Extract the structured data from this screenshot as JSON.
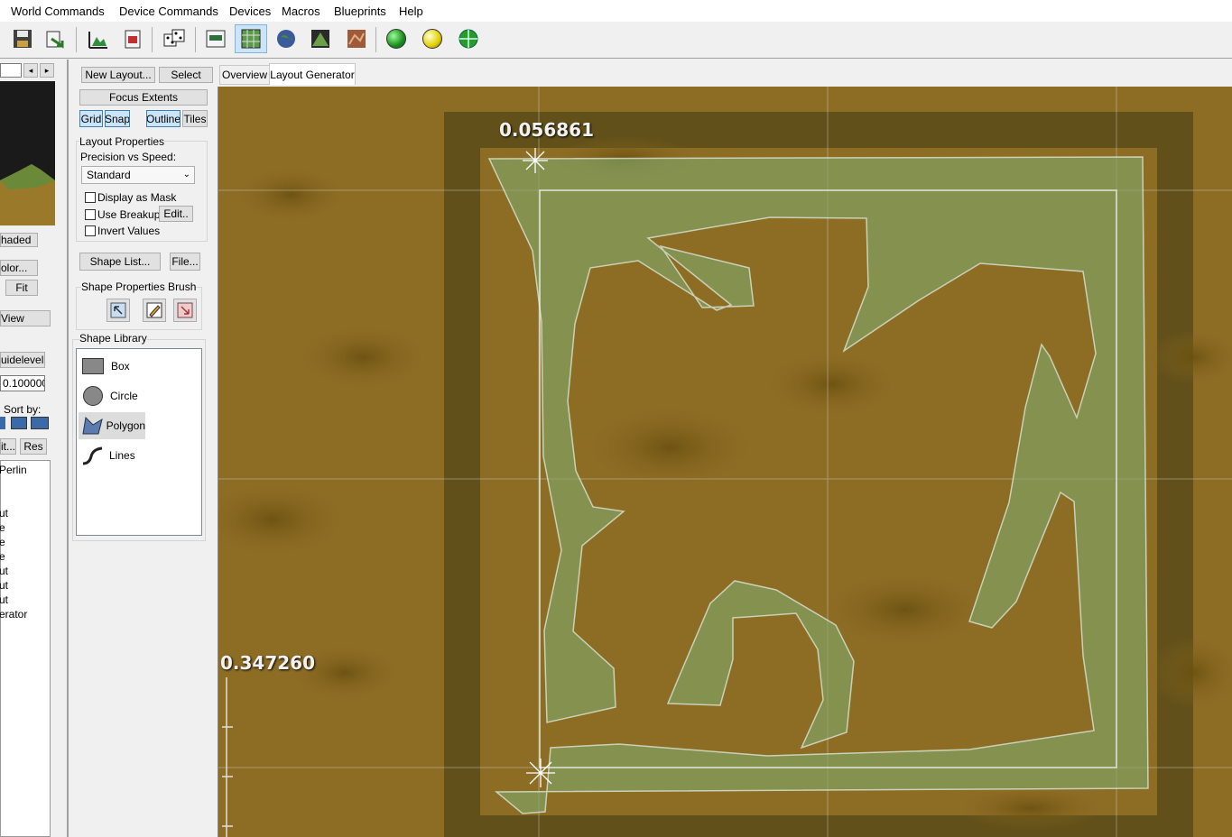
{
  "menubar": {
    "items": [
      "World Commands",
      "Device Commands",
      "Devices",
      "Macros",
      "Blueprints",
      "Help"
    ]
  },
  "toolbar": {
    "icons": [
      "save-icon",
      "export-icon",
      "terrain-view-icon",
      "build-icon",
      "randomize-icon",
      "device-view-icon",
      "layout-grid-icon",
      "globe-icon",
      "mountain-icon",
      "texture-icon",
      "green-orb-icon",
      "yellow-orb-icon",
      "globe-grid-icon"
    ]
  },
  "left_strip": {
    "nav_prev": "◂",
    "nav_next": "▸",
    "shaded_label": "haded",
    "color_button": "olor...",
    "fit_button": "Fit",
    "view_button": "View",
    "guidelevel_button": "uidelevel",
    "guidelevel_value": "0.100000",
    "sort_label": "Sort by:",
    "edit_button": "it...",
    "res_button": "Res",
    "device_list": [
      "Perlin",
      "",
      "",
      "ut",
      "e",
      "e",
      "e",
      "ut",
      "ut",
      "ut",
      "erator"
    ]
  },
  "tool_panel": {
    "new_layout": "New Layout...",
    "select": "Select",
    "focus_extents": "Focus Extents",
    "grid": "Grid",
    "snap": "Snap",
    "outline": "Outline",
    "tiles": "Tiles",
    "layout_properties": {
      "title": "Layout Properties",
      "precision_label": "Precision vs Speed:",
      "precision_value": "Standard",
      "display_as_mask": "Display as Mask",
      "use_breakup": "Use Breakup",
      "edit_button": "Edit..",
      "invert_values": "Invert Values"
    },
    "shape_list": "Shape List...",
    "file": "File...",
    "shape_properties_brush": "Shape Properties Brush",
    "shape_library": {
      "title": "Shape Library",
      "items": [
        "Box",
        "Circle",
        "Polygon",
        "Lines"
      ],
      "selected": "Polygon"
    }
  },
  "tabs": {
    "items": [
      "Overview",
      "Layout Generator"
    ],
    "active": "Layout Generator"
  },
  "viewport": {
    "top_readout": "0.056861",
    "left_readout": "0.347260"
  },
  "colors": {
    "terrain": "#8a6a22",
    "shape_fill": "#7fa86a",
    "outline": "#d8e4d8",
    "selection": "#cce4f7"
  }
}
